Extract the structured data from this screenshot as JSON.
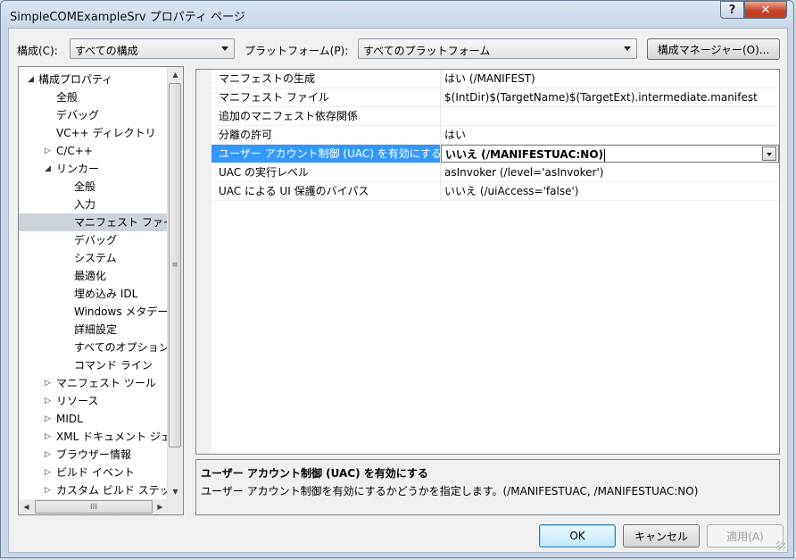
{
  "window": {
    "title": "SimpleCOMExampleSrv プロパティ ページ",
    "help_glyph": "?",
    "close_glyph": "✕"
  },
  "toolbar": {
    "config_label": "構成(C):",
    "config_value": "すべての構成",
    "platform_label": "プラットフォーム(P):",
    "platform_value": "すべてのプラットフォーム",
    "config_manager": "構成マネージャー(O)..."
  },
  "tree": {
    "items": [
      {
        "label": "構成プロパティ",
        "level": 0,
        "expander": "◢"
      },
      {
        "label": "全般",
        "level": 1,
        "expander": ""
      },
      {
        "label": "デバッグ",
        "level": 1,
        "expander": ""
      },
      {
        "label": "VC++ ディレクトリ",
        "level": 1,
        "expander": ""
      },
      {
        "label": "C/C++",
        "level": 1,
        "expander": "▷"
      },
      {
        "label": "リンカー",
        "level": 1,
        "expander": "◢"
      },
      {
        "label": "全般",
        "level": 2,
        "expander": ""
      },
      {
        "label": "入力",
        "level": 2,
        "expander": ""
      },
      {
        "label": "マニフェスト ファイル",
        "level": 2,
        "expander": "",
        "selected": true
      },
      {
        "label": "デバッグ",
        "level": 2,
        "expander": ""
      },
      {
        "label": "システム",
        "level": 2,
        "expander": ""
      },
      {
        "label": "最適化",
        "level": 2,
        "expander": ""
      },
      {
        "label": "埋め込み IDL",
        "level": 2,
        "expander": ""
      },
      {
        "label": "Windows メタデータ",
        "level": 2,
        "expander": ""
      },
      {
        "label": "詳細設定",
        "level": 2,
        "expander": ""
      },
      {
        "label": "すべてのオプション",
        "level": 2,
        "expander": ""
      },
      {
        "label": "コマンド ライン",
        "level": 2,
        "expander": ""
      },
      {
        "label": "マニフェスト ツール",
        "level": 1,
        "expander": "▷"
      },
      {
        "label": "リソース",
        "level": 1,
        "expander": "▷"
      },
      {
        "label": "MIDL",
        "level": 1,
        "expander": "▷"
      },
      {
        "label": "XML ドキュメント ジェネレーター",
        "level": 1,
        "expander": "▷"
      },
      {
        "label": "ブラウザー情報",
        "level": 1,
        "expander": "▷"
      },
      {
        "label": "ビルド イベント",
        "level": 1,
        "expander": "▷"
      },
      {
        "label": "カスタム ビルド ステップ",
        "level": 1,
        "expander": "▷"
      }
    ],
    "vscroll": {
      "up": "▲",
      "down": "▼",
      "grip": "≡"
    },
    "hscroll": {
      "left": "◀",
      "right": "▶",
      "grip": "III"
    }
  },
  "properties": [
    {
      "name": "マニフェストの生成",
      "value": "はい (/MANIFEST)"
    },
    {
      "name": "マニフェスト ファイル",
      "value": "$(IntDir)$(TargetName)$(TargetExt).intermediate.manifest"
    },
    {
      "name": "追加のマニフェスト依存関係",
      "value": ""
    },
    {
      "name": "分離の許可",
      "value": "はい"
    },
    {
      "name": "ユーザー アカウント制御 (UAC) を有効にする",
      "value": "いいえ (/MANIFESTUAC:NO)",
      "selected": true
    },
    {
      "name": "UAC の実行レベル",
      "value": "asInvoker (/level='asInvoker')"
    },
    {
      "name": "UAC による UI 保護のバイパス",
      "value": "いいえ (/uiAccess='false')"
    }
  ],
  "description": {
    "title": "ユーザー アカウント制御 (UAC) を有効にする",
    "text": "ユーザー アカウント制御を有効にするかどうかを指定します。(/MANIFESTUAC, /MANIFESTUAC:NO)"
  },
  "buttons": {
    "ok": "OK",
    "cancel": "キャンセル",
    "apply": "適用(A)"
  }
}
